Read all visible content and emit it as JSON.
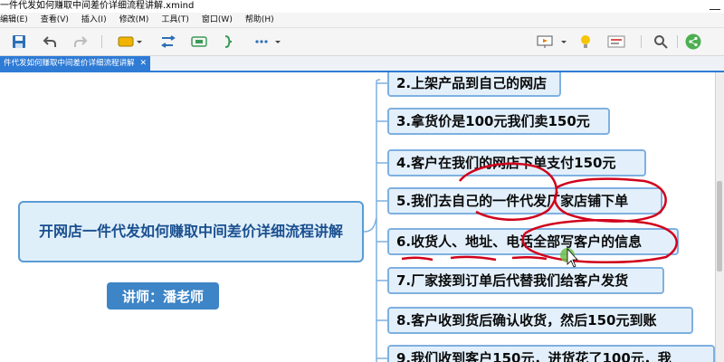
{
  "window": {
    "title": "一件代发如何赚取中间差价详细流程讲解.xmind"
  },
  "menu": {
    "items": [
      "编辑(E)",
      "查看(V)",
      "插入(I)",
      "修改(M)",
      "工具(T)",
      "窗口(W)",
      "帮助(H)"
    ]
  },
  "tab": {
    "label": "件代发如何赚取中间差价详细流程讲解",
    "close": "✕"
  },
  "mindmap": {
    "central_topic": "开网店一件代发如何赚取中间差价详细流程讲解",
    "lecturer": "讲师：潘老师",
    "subtopics": [
      "2.上架产品到自己的网店",
      "3.拿货价是100元我们卖150元",
      "4.客户在我们的网店下单支付150元",
      "5.我们去自己的一件代发厂家店铺下单",
      "6.收货人、地址、电话全部写客户的信息",
      "7.厂家接到订单后代替我们给客户发货",
      "8.客户收到货后确认收货，然后150元到账",
      "9.我们收到客户150元，进货花了100元，我"
    ]
  },
  "colors": {
    "accent": "#2e7bd6",
    "central_fill": "#dfeffa",
    "lecturer_fill": "#3d85c6",
    "topic_fill": "#e3f0fb",
    "annotation": "#d0021b"
  }
}
